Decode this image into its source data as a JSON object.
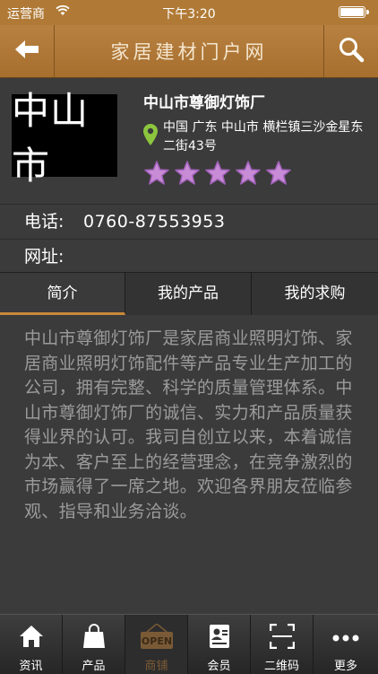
{
  "status_bar": {
    "carrier": "运营商",
    "time": "下午3:20",
    "battery_level": 1.0
  },
  "nav": {
    "title": "家居建材门户网",
    "back_icon": "back-arrow-icon",
    "search_icon": "search-icon"
  },
  "store": {
    "logo_text": "中山市",
    "name": "中山市尊御灯饰厂",
    "address": "中国 广东 中山市 横栏镇三沙金星东二街43号",
    "rating": 5,
    "rating_max": 5
  },
  "info": {
    "phone_label": "电话:",
    "phone": "0760-87553953",
    "website_label": "网址:",
    "website": ""
  },
  "tabs": [
    {
      "label": "简介",
      "active": true
    },
    {
      "label": "我的产品",
      "active": false
    },
    {
      "label": "我的求购",
      "active": false
    }
  ],
  "intro": "中山市尊御灯饰厂是家居商业照明灯饰、家居商业照明灯饰配件等产品专业生产加工的公司，拥有完整、科学的质量管理体系。中山市尊御灯饰厂的诚信、实力和产品质量获得业界的认可。我司自创立以来，本着诚信为本、客户至上的经营理念，在竞争激烈的市场赢得了一席之地。欢迎各界朋友莅临参观、指导和业务洽谈。",
  "bottom_tabs": [
    {
      "label": "资讯",
      "icon": "home-icon",
      "active": false
    },
    {
      "label": "产品",
      "icon": "shopping-bag-icon",
      "active": false
    },
    {
      "label": "商铺",
      "icon": "open-sign-icon",
      "active": true,
      "sign_text": "OPEN"
    },
    {
      "label": "会员",
      "icon": "member-card-icon",
      "active": false
    },
    {
      "label": "二维码",
      "icon": "qr-scan-icon",
      "active": false
    },
    {
      "label": "更多",
      "icon": "more-dots-icon",
      "active": false
    }
  ],
  "colors": {
    "accent": "#b07a36",
    "star": "#c88bd6",
    "pin": "#8cc63f"
  }
}
